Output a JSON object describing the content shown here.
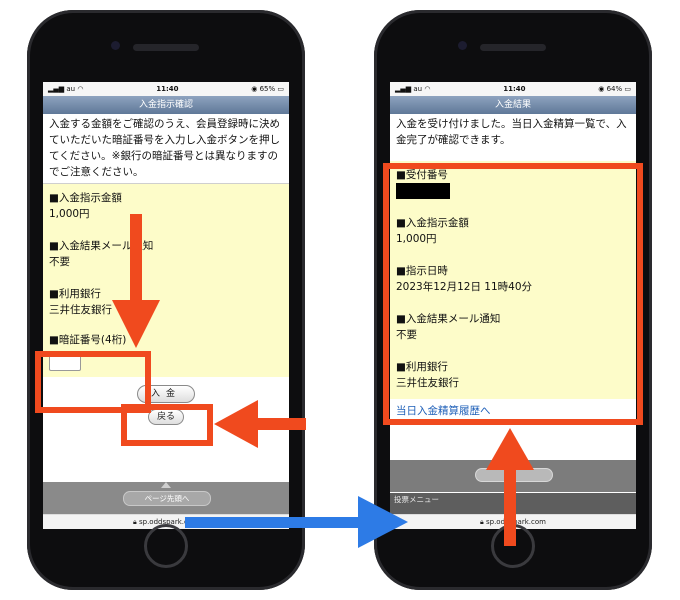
{
  "left_phone": {
    "status": {
      "carrier": "au",
      "time": "11:40",
      "battery": "65%"
    },
    "nav_title": "入金指示確認",
    "intro_text": "入金する金額をご確認のうえ、会員登録時に決めていただいた暗証番号を入力し入金ボタンを押してください。※銀行の暗証番号とは異なりますのでご注意ください。",
    "items": [
      {
        "label": "■入金指示金額",
        "value": "1,000円"
      },
      {
        "label": "■入金結果メール通知",
        "value": "不要"
      },
      {
        "label": "■利用銀行",
        "value": "三井住友銀行"
      }
    ],
    "pin_label": "■暗証番号(4桁)",
    "deposit_button": "入金",
    "back_button": "戻る",
    "page_top_button": "ページ先頭へ",
    "url": "sp.oddspark.com"
  },
  "right_phone": {
    "status": {
      "carrier": "au",
      "time": "11:40",
      "battery": "64%"
    },
    "nav_title": "入金結果",
    "intro_text": "入金を受け付けました。当日入金精算一覧で、入金完了が確認できます。",
    "items": [
      {
        "label": "■受付番号",
        "value": ""
      },
      {
        "label": "■入金指示金額",
        "value": "1,000円"
      },
      {
        "label": "■指示日時",
        "value": "2023年12月12日 11時40分"
      },
      {
        "label": "■入金結果メール通知",
        "value": "不要"
      },
      {
        "label": "■利用銀行",
        "value": "三井住友銀行"
      }
    ],
    "history_link": "当日入金精算履歴へ",
    "bottom_menu": "投票メニュー",
    "url": "sp.oddspark.com"
  },
  "colors": {
    "highlight": "#f04a1e",
    "flow_arrow": "#2d7be6",
    "yellow_panel": "#fdfcc9",
    "nav_bar": "#6f87a8"
  }
}
